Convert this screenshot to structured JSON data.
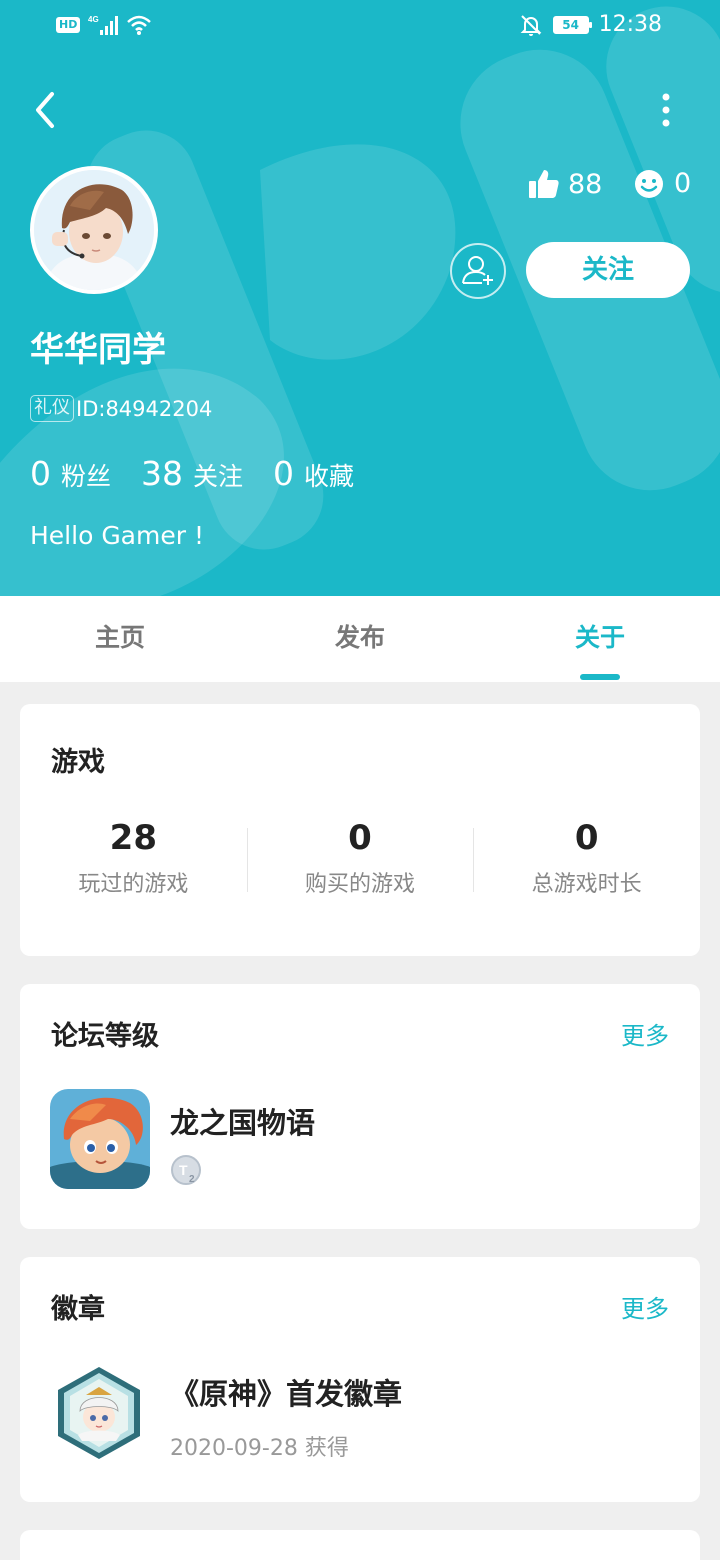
{
  "status_bar": {
    "network": "HD",
    "cell": "4G",
    "battery": "54",
    "time": "12:38"
  },
  "profile": {
    "username": "华华同学",
    "tag": "礼仪",
    "id_text": "ID:84942204",
    "likes": "88",
    "smiles": "0",
    "follow_label": "关注",
    "bio": "Hello Gamer !",
    "counts": [
      {
        "num": "0",
        "label": "粉丝"
      },
      {
        "num": "38",
        "label": "关注"
      },
      {
        "num": "0",
        "label": "收藏"
      }
    ]
  },
  "tabs": [
    {
      "label": "主页",
      "active": false
    },
    {
      "label": "发布",
      "active": false
    },
    {
      "label": "关于",
      "active": true
    }
  ],
  "games_card": {
    "title": "游戏",
    "stats": [
      {
        "num": "28",
        "label": "玩过的游戏"
      },
      {
        "num": "0",
        "label": "购买的游戏"
      },
      {
        "num": "0",
        "label": "总游戏时长"
      }
    ]
  },
  "forum_card": {
    "title": "论坛等级",
    "more": "更多",
    "game_name": "龙之国物语",
    "level_icon": "level-t2-icon"
  },
  "badge_card": {
    "title": "徽章",
    "more": "更多",
    "badge_name": "《原神》首发徽章",
    "badge_date": "2020-09-28 获得"
  },
  "colors": {
    "accent": "#1bb8c8",
    "background": "#efefef",
    "card": "#ffffff"
  }
}
